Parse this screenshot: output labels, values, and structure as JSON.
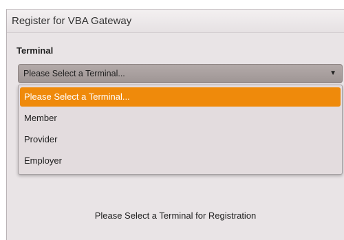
{
  "window": {
    "title": "Register for VBA Gateway"
  },
  "form": {
    "terminal_label": "Terminal",
    "select": {
      "value": "Please Select a Terminal...",
      "caret_icon": "▼"
    },
    "options": [
      {
        "label": "Please Select a Terminal...",
        "selected": true
      },
      {
        "label": "Member",
        "selected": false
      },
      {
        "label": "Provider",
        "selected": false
      },
      {
        "label": "Employer",
        "selected": false
      }
    ]
  },
  "message": "Please Select a Terminal for Registration",
  "colors": {
    "highlight": "#ef8a0b",
    "select_bg": "#a89f9e",
    "panel_bg": "#e9e4e6"
  }
}
